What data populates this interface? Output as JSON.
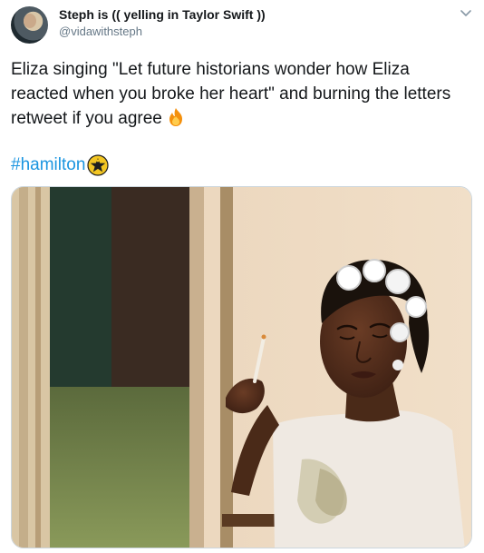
{
  "tweet": {
    "display_name": "Steph is (( yelling in Taylor Swift ))",
    "handle": "@vidawithsteph",
    "text": "Eliza singing \"Let future historians wonder how Eliza reacted when you broke her heart\" and burning the letters retweet if you agree",
    "text_emoji": "fire-emoji",
    "hashtag": "#hamilton",
    "hashflag_icon": "hamilton-star-icon",
    "menu_icon": "chevron-down-icon"
  },
  "media": {
    "type": "photo",
    "subject": "woman-in-hair-rollers-holding-cigarette"
  },
  "colors": {
    "link": "#1b95e0",
    "secondary_text": "#657786",
    "primary_text": "#14171a",
    "border": "#ccd6dd"
  }
}
